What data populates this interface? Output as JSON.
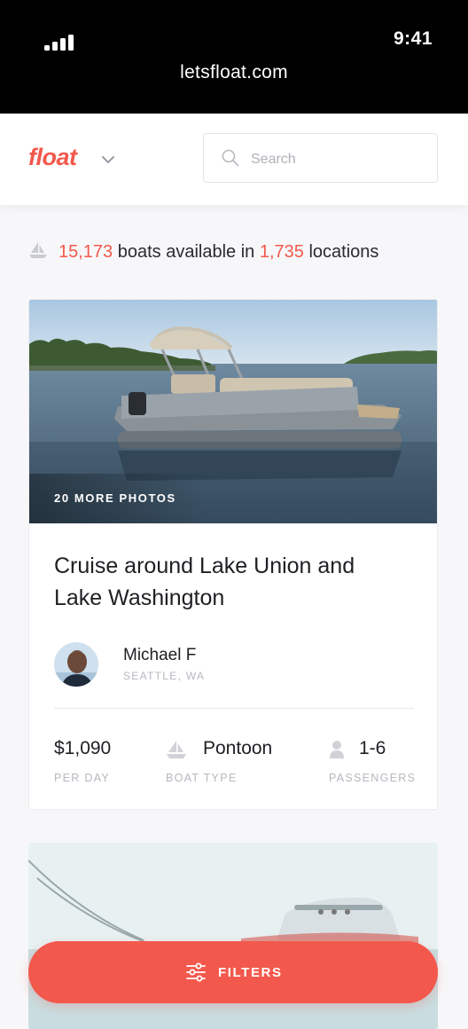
{
  "status_bar": {
    "time": "9:41",
    "url": "letsfloat.com"
  },
  "header": {
    "logo": "float",
    "search_placeholder": "Search"
  },
  "availability": {
    "boats_count": "15,173",
    "boats_text": "boats available in",
    "locations_count": "1,735",
    "locations_text": "locations"
  },
  "listing": {
    "more_photos": "20 MORE PHOTOS",
    "title": "Cruise around Lake Union and Lake Washington",
    "host_name": "Michael F",
    "host_location": "SEATTLE, WA",
    "price": "$1,090",
    "price_label": "PER DAY",
    "boat_type": "Pontoon",
    "boat_type_label": "BOAT TYPE",
    "passengers": "1-6",
    "passengers_label": "PASSENGERS"
  },
  "filters": {
    "label": "FILTERS"
  },
  "colors": {
    "accent": "#f3584c",
    "muted": "#b6b8bf",
    "text": "#1f1f24"
  },
  "icons": [
    "signal-icon",
    "chevron-down-icon",
    "search-icon",
    "sailboat-icon",
    "person-icon",
    "sliders-icon"
  ]
}
